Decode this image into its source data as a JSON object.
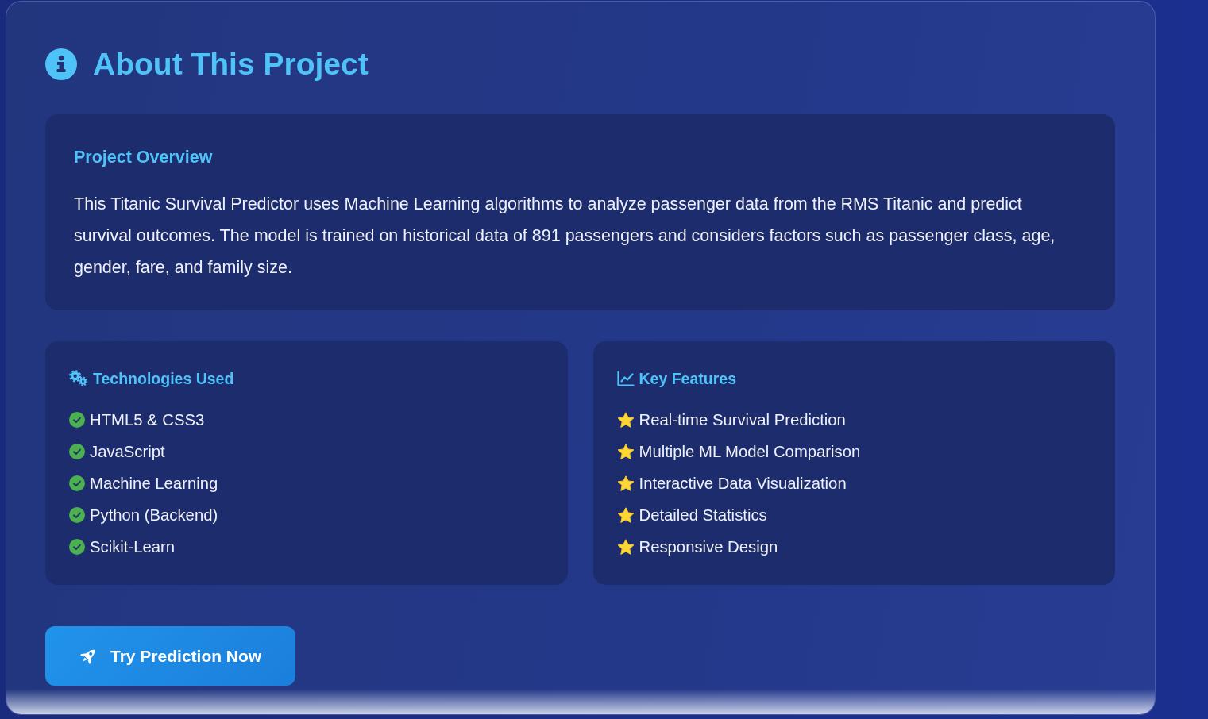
{
  "header": {
    "title": "About This Project"
  },
  "overview": {
    "title": "Project Overview",
    "text": "This Titanic Survival Predictor uses Machine Learning algorithms to analyze passenger data from the RMS Titanic and predict survival outcomes. The model is trained on historical data of 891 passengers and considers factors such as passenger class, age, gender, fare, and family size."
  },
  "panels": [
    {
      "kind": "technologies",
      "title": "Technologies Used",
      "items": [
        "HTML5 & CSS3",
        "JavaScript",
        "Machine Learning",
        "Python (Backend)",
        "Scikit-Learn"
      ]
    },
    {
      "kind": "features",
      "title": "Key Features",
      "items": [
        "Real-time Survival Prediction",
        "Multiple ML Model Comparison",
        "Interactive Data Visualization",
        "Detailed Statistics",
        "Responsive Design"
      ]
    }
  ],
  "button": {
    "label": "Try Prediction Now"
  }
}
